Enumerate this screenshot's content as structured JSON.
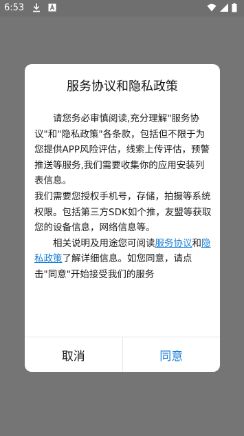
{
  "status_bar": {
    "time": "6:53",
    "left_icons": [
      "download-icon",
      "notification-a-icon"
    ],
    "right_icons": [
      "wifi-icon",
      "signal-icon",
      "battery-icon"
    ]
  },
  "dialog": {
    "title": "服务协议和隐私政策",
    "para1": "请您务必审慎阅读,充分理解\"服务协议\"和\"隐私政策\"各条款，包括但不限于为您提供APP风险评估，线索上传评估，预警推送等服务,我们需要收集你的应用安装列表信息。",
    "para2": "我们需要您授权手机号，存储，拍摄等系统权限。包括第三方SDK如个推，友盟等获取您的设备信息，网络信息等。",
    "para3_prefix": "相关说明及用途您可阅读",
    "link_service": "服务协议",
    "para3_and": "和",
    "link_privacy": "隐私政策",
    "para3_suffix": "了解详细信息。如您同意，请点击\"同意\"开始接受我们的服务",
    "cancel_label": "取消",
    "agree_label": "同意"
  },
  "colors": {
    "overlay": "#757575",
    "link": "#1b7fd6",
    "dialog_bg": "#ffffff"
  }
}
